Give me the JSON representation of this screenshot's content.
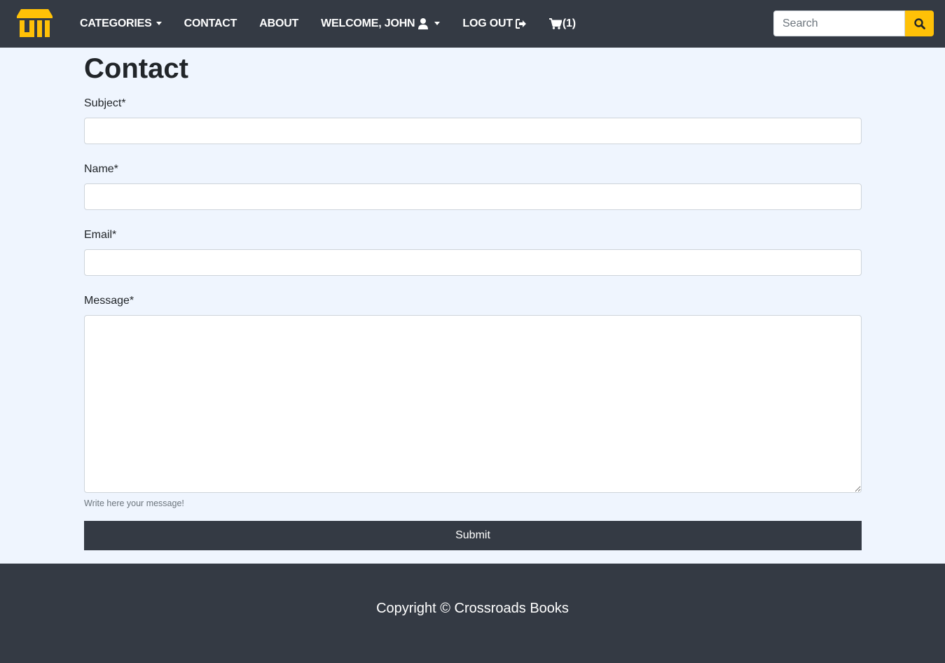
{
  "brand": {
    "logo_icon": "storefront-icon",
    "accent_color": "#ffc107"
  },
  "nav": {
    "categories_label": "CATEGORIES",
    "contact_label": "CONTACT",
    "about_label": "ABOUT",
    "welcome_label": "WELCOME, JOHN",
    "logout_label": "LOG OUT",
    "cart_count": "(1)"
  },
  "search": {
    "placeholder": "Search",
    "button_icon": "search-icon"
  },
  "page": {
    "title": "Contact"
  },
  "form": {
    "subject_label": "Subject*",
    "name_label": "Name*",
    "email_label": "Email*",
    "message_label": "Message*",
    "message_help": "Write here your message!",
    "submit_label": "Submit"
  },
  "footer": {
    "copyright": "Copyright © Crossroads Books"
  },
  "colors": {
    "navbar_bg": "#343a44",
    "page_bg": "#eff5fe",
    "button_bg": "#343a44"
  }
}
